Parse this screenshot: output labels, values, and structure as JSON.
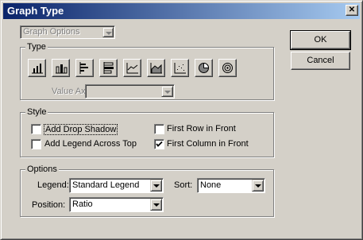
{
  "window": {
    "title": "Graph Type",
    "close_glyph": "✕"
  },
  "graph_options": {
    "value": "Graph Options"
  },
  "type_group": {
    "label": "Type",
    "buttons": [
      {
        "icon": "column-graph-icon"
      },
      {
        "icon": "stacked-column-graph-icon"
      },
      {
        "icon": "bar-graph-icon"
      },
      {
        "icon": "stacked-bar-graph-icon"
      },
      {
        "icon": "line-graph-icon"
      },
      {
        "icon": "area-graph-icon"
      },
      {
        "icon": "scatter-graph-icon"
      },
      {
        "icon": "pie-graph-icon"
      },
      {
        "icon": "radar-graph-icon"
      }
    ],
    "value_axis_label": "Value Axis:",
    "value_axis_value": ""
  },
  "style_group": {
    "label": "Style",
    "add_drop_shadow": {
      "label": "Add Drop Shadow",
      "checked": false
    },
    "add_legend_across_top": {
      "label": "Add Legend Across Top",
      "checked": false
    },
    "first_row_in_front": {
      "label": "First Row in Front",
      "checked": false
    },
    "first_column_in_front": {
      "label": "First Column in Front",
      "checked": true
    }
  },
  "options_group": {
    "label": "Options",
    "legend_label": "Legend:",
    "legend_value": "Standard Legend",
    "sort_label": "Sort:",
    "sort_value": "None",
    "position_label": "Position:",
    "position_value": "Ratio"
  },
  "buttons": {
    "ok": "OK",
    "cancel": "Cancel"
  }
}
